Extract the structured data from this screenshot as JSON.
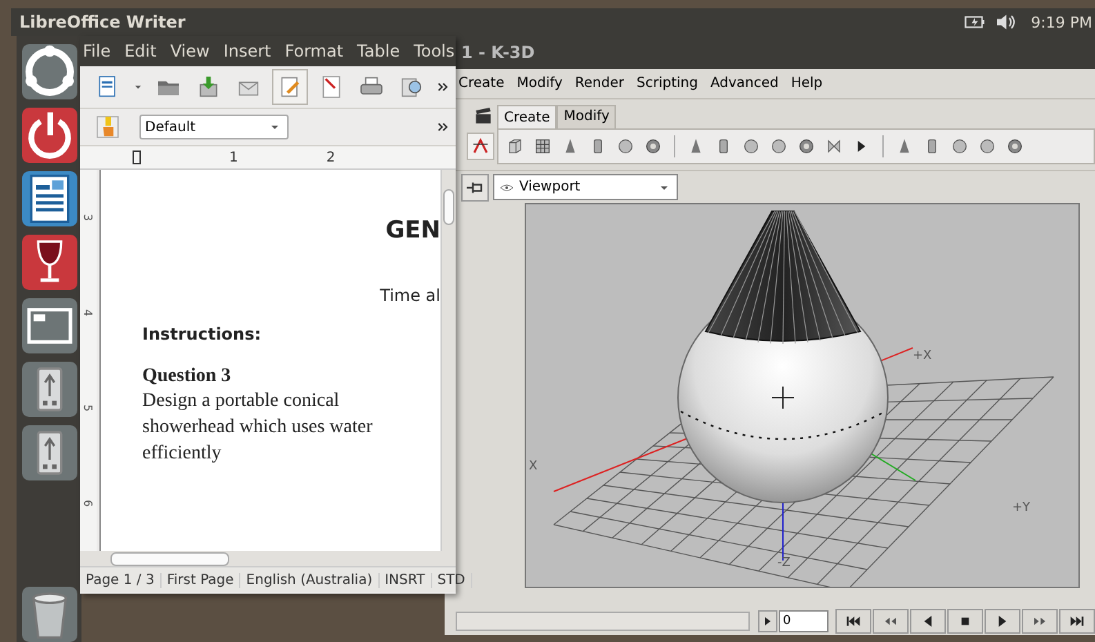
{
  "top_panel": {
    "title": "LibreOffice Writer",
    "clock": "9:19 PM"
  },
  "writer": {
    "menu": [
      "File",
      "Edit",
      "View",
      "Insert",
      "Format",
      "Table",
      "Tools"
    ],
    "paragraph_style": "Default",
    "ruler_numbers": [
      "1",
      "2"
    ],
    "vertical_ruler": [
      "3",
      "4",
      "5",
      "6"
    ],
    "document": {
      "heading": "GEN",
      "time_line": "Time al",
      "instructions": "Instructions:",
      "question": "Question 3",
      "body": "Design a portable conical showerhead which uses water efficiently"
    },
    "status_bar": [
      "Page 1 / 3",
      "First Page",
      "English (Australia)",
      "INSRT",
      "STD"
    ]
  },
  "k3d": {
    "title": "1 - K-3D",
    "menu": [
      "Create",
      "Modify",
      "Render",
      "Scripting",
      "Advanced",
      "Help"
    ],
    "tabs": [
      {
        "label": "Create",
        "selected": true
      },
      {
        "label": "Modify",
        "selected": false
      }
    ],
    "viewport_selector": "Viewport",
    "axis_labels": [
      "+X",
      "X",
      "+Y",
      "-Z"
    ],
    "frame_field": "0"
  }
}
